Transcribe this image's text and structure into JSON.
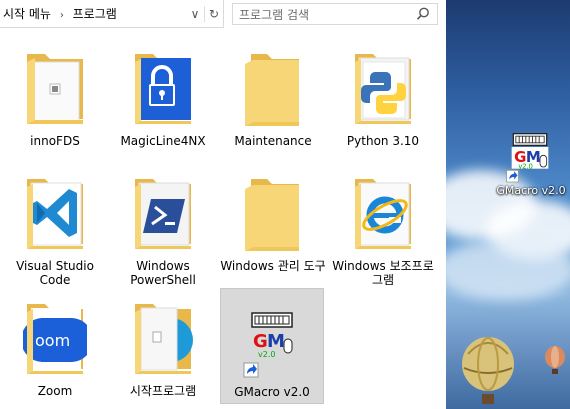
{
  "breadcrumb": {
    "segments": [
      "시작 메뉴",
      "프로그램"
    ]
  },
  "address_actions": {
    "dropdown": "∨",
    "refresh": "↻"
  },
  "search": {
    "placeholder": "프로그램 검색"
  },
  "items": [
    {
      "label": "innoFDS",
      "icon": "folder-innofds-icon"
    },
    {
      "label": "MagicLine4NX",
      "icon": "folder-magicline-icon"
    },
    {
      "label": "Maintenance",
      "icon": "folder-icon"
    },
    {
      "label": "Python 3.10",
      "icon": "folder-python-icon"
    },
    {
      "label": "Visual Studio Code",
      "icon": "folder-vscode-icon"
    },
    {
      "label": "Windows PowerShell",
      "icon": "folder-powershell-icon"
    },
    {
      "label": "Windows 관리 도구",
      "icon": "folder-icon"
    },
    {
      "label": "Windows 보조프로그램",
      "icon": "folder-ie-icon"
    },
    {
      "label": "Zoom",
      "icon": "folder-zoom-icon"
    },
    {
      "label": "시작프로그램",
      "icon": "folder-startup-icon"
    },
    {
      "label": "GMacro v2.0",
      "icon": "gmacro-shortcut-icon",
      "selected": true
    }
  ],
  "desktop": {
    "shortcut_label": "GMacro v2.0",
    "icon": "gmacro-shortcut-icon"
  },
  "colors": {
    "folder": "#f7d677",
    "folder_dark": "#e8b94a",
    "selection": "#d9d9d9"
  }
}
